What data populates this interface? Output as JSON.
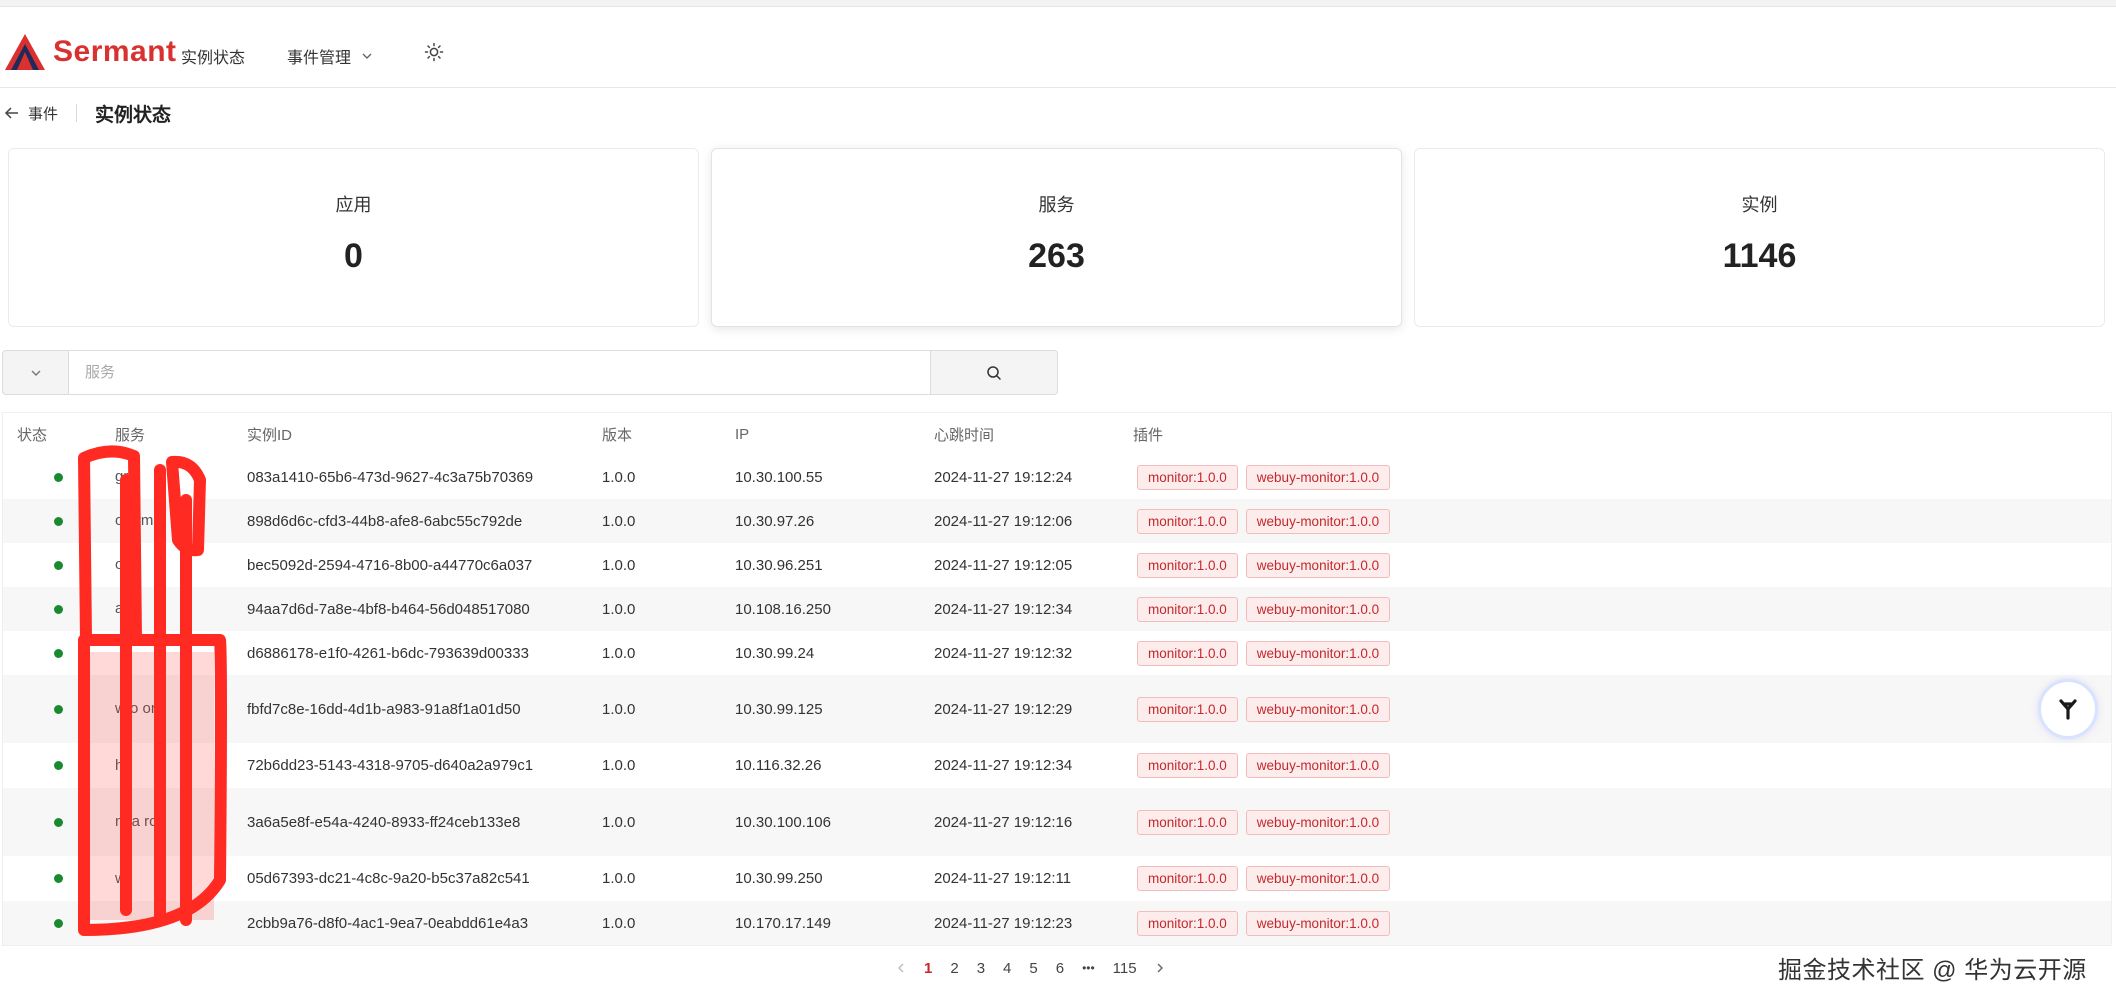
{
  "app": {
    "logo_text": "Sermant",
    "brand_color": "#d93030",
    "tag_color": "#c4282c",
    "status_ok_color": "#1a8a2e"
  },
  "nav": {
    "instances_label": "实例状态",
    "events_label": "事件管理",
    "theme_icon": "sun-icon"
  },
  "breadcrumb": {
    "back_label": "事件",
    "title": "实例状态"
  },
  "stats": [
    {
      "label": "应用",
      "value": "0"
    },
    {
      "label": "服务",
      "value": "263"
    },
    {
      "label": "实例",
      "value": "1146"
    }
  ],
  "search": {
    "placeholder": "服务",
    "value": ""
  },
  "table": {
    "headers": {
      "status": "状态",
      "service": "服务",
      "instance_id": "实例ID",
      "version": "版本",
      "ip": "IP",
      "heartbeat": "心跳时间",
      "plugins": "插件"
    },
    "rows": [
      {
        "service": "gr",
        "instance_id": "083a1410-65b6-473d-9627-4c3a75b70369",
        "version": "1.0.0",
        "ip": "10.30.100.55",
        "heartbeat": "2024-11-27 19:12:24",
        "plugins": [
          "monitor:1.0.0",
          "webuy-monitor:1.0.0"
        ]
      },
      {
        "service": "op           rm",
        "instance_id": "898d6d6c-cfd3-44b8-afe8-6abc55c792de",
        "version": "1.0.0",
        "ip": "10.30.97.26",
        "heartbeat": "2024-11-27 19:12:06",
        "plugins": [
          "monitor:1.0.0",
          "webuy-monitor:1.0.0"
        ]
      },
      {
        "service": "or",
        "instance_id": "bec5092d-2594-4716-8b00-a44770c6a037",
        "version": "1.0.0",
        "ip": "10.30.96.251",
        "heartbeat": "2024-11-27 19:12:05",
        "plugins": [
          "monitor:1.0.0",
          "webuy-monitor:1.0.0"
        ]
      },
      {
        "service": "at           b",
        "instance_id": "94aa7d6d-7a8e-4bf8-b464-56d048517080",
        "version": "1.0.0",
        "ip": "10.108.16.250",
        "heartbeat": "2024-11-27 19:12:34",
        "plugins": [
          "monitor:1.0.0",
          "webuy-monitor:1.0.0"
        ]
      },
      {
        "service": "",
        "instance_id": "d6886178-e1f0-4261-b6dc-793639d00333",
        "version": "1.0.0",
        "ip": "10.30.99.24",
        "heartbeat": "2024-11-27 19:12:32",
        "plugins": [
          "monitor:1.0.0",
          "webuy-monitor:1.0.0"
        ]
      },
      {
        "service": "w            o or",
        "instance_id": "fbfd7c8e-16dd-4d1b-a983-91a8f1a01d50",
        "version": "1.0.0",
        "ip": "10.30.99.125",
        "heartbeat": "2024-11-27 19:12:29",
        "plugins": [
          "monitor:1.0.0",
          "webuy-monitor:1.0.0"
        ]
      },
      {
        "service": "ha",
        "instance_id": "72b6dd23-5143-4318-9705-d640a2a979c1",
        "version": "1.0.0",
        "ip": "10.116.32.26",
        "heartbeat": "2024-11-27 19:12:34",
        "plugins": [
          "monitor:1.0.0",
          "webuy-monitor:1.0.0"
        ]
      },
      {
        "service": "m            a rc",
        "instance_id": "3a6a5e8f-e54a-4240-8933-ff24ceb133e8",
        "version": "1.0.0",
        "ip": "10.30.100.106",
        "heartbeat": "2024-11-27 19:12:16",
        "plugins": [
          "monitor:1.0.0",
          "webuy-monitor:1.0.0"
        ]
      },
      {
        "service": "w",
        "instance_id": "05d67393-dc21-4c8c-9a20-b5c37a82c541",
        "version": "1.0.0",
        "ip": "10.30.99.250",
        "heartbeat": "2024-11-27 19:12:11",
        "plugins": [
          "monitor:1.0.0",
          "webuy-monitor:1.0.0"
        ]
      },
      {
        "service": "",
        "instance_id": "2cbb9a76-d8f0-4ac1-9ea7-0eabdd61e4a3",
        "version": "1.0.0",
        "ip": "10.170.17.149",
        "heartbeat": "2024-11-27 19:12:23",
        "plugins": [
          "monitor:1.0.0",
          "webuy-monitor:1.0.0"
        ]
      }
    ]
  },
  "pagination": {
    "pages": [
      "1",
      "2",
      "3",
      "4",
      "5",
      "6"
    ],
    "active": "1",
    "ellipsis": "•••",
    "last": "115"
  },
  "watermark": "掘金技术社区 @ 华为云开源"
}
